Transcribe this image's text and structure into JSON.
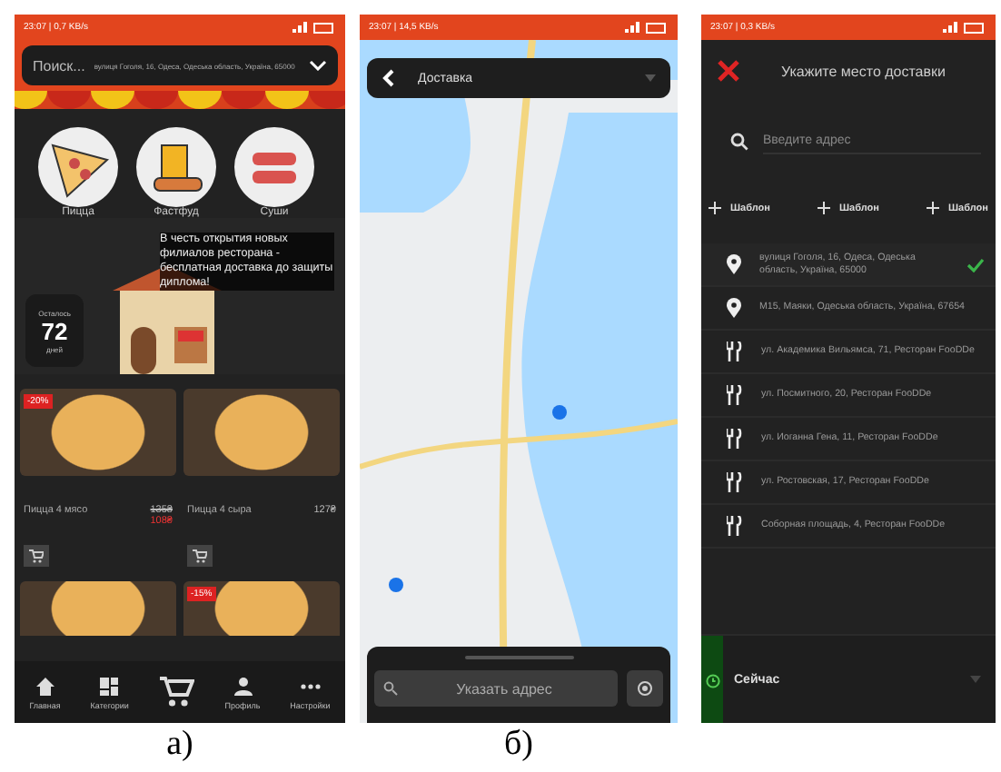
{
  "screen_a": {
    "status": "23:07 | 0,7 KB/s",
    "search": {
      "placeholder": "Поиск...",
      "address": "вулиця Гоголя, 16, Одеса, Одеська область, Україна, 65000"
    },
    "categories": [
      {
        "label": "Пицца",
        "kind": "pizza"
      },
      {
        "label": "Фастфуд",
        "kind": "fastfood"
      },
      {
        "label": "Суши",
        "kind": "sushi"
      }
    ],
    "promo": {
      "text": "В честь открытия новых филиалов ресторана - бесплатная доставка до защиты диплома!",
      "countdown_caption": "Осталось",
      "countdown_value": "72",
      "countdown_unit": "дней"
    },
    "products": [
      {
        "name": "Пицца 4 мясо",
        "old_price": "135₴",
        "price": "108₴",
        "discount": "-20%"
      },
      {
        "name": "Пицца 4 сыра",
        "price": "127₴"
      }
    ],
    "partial_products": [
      {
        "kind": "plain"
      },
      {
        "kind": "discounted",
        "discount": "-15%"
      }
    ],
    "nav": [
      {
        "kind": "home",
        "label": "Главная"
      },
      {
        "kind": "grid",
        "label": "Категории"
      },
      {
        "kind": "cart"
      },
      {
        "kind": "person",
        "label": "Профиль"
      },
      {
        "kind": "dots",
        "label": "Настройки"
      }
    ],
    "caption": "а)"
  },
  "screen_b": {
    "status": "23:07 | 14,5 KB/s",
    "title": "Доставка",
    "search": {
      "placeholder": "Указать адрес"
    },
    "caption": "б)"
  },
  "screen_c": {
    "status": "23:07 | 0,3 KB/s",
    "title": "Укажите место доставки",
    "search": {
      "placeholder": "Введите адрес"
    },
    "templates": [
      "Шаблон",
      "Шаблон",
      "Шаблон"
    ],
    "addresses": [
      {
        "kind": "pin",
        "text": "вулиця Гоголя, 16, Одеса, Одеська область, Україна, 65000",
        "selected": true
      },
      {
        "kind": "pin",
        "text": "M15, Маяки, Одеська область, Україна, 67654",
        "selected": false
      },
      {
        "kind": "restaurant",
        "text": "ул. Академика Вильямса, 71, Ресторан FooDDe",
        "selected": false
      },
      {
        "kind": "restaurant",
        "text": "ул. Посмитного, 20, Ресторан FooDDe",
        "selected": false
      },
      {
        "kind": "restaurant",
        "text": "ул. Иоганна Гена, 11, Ресторан FooDDe",
        "selected": false
      },
      {
        "kind": "restaurant",
        "text": "ул. Ростовская, 17, Ресторан FooDDe",
        "selected": false
      },
      {
        "kind": "restaurant",
        "text": "Соборная площадь, 4, Ресторан FooDDe",
        "selected": false
      }
    ],
    "time": {
      "label": "Сейчас"
    }
  }
}
